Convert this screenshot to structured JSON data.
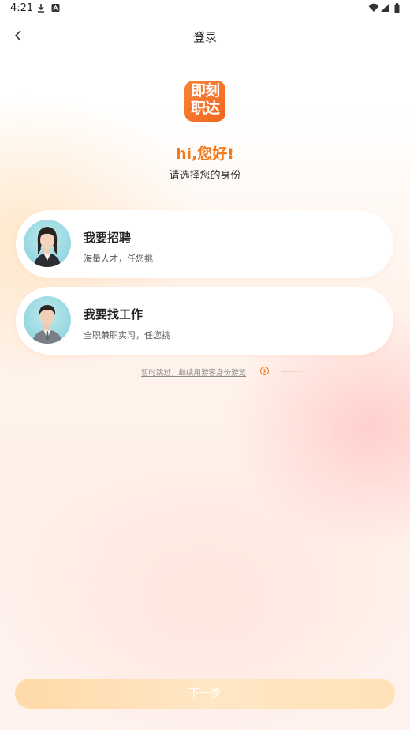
{
  "status_bar": {
    "time": "4:21"
  },
  "header": {
    "title": "登录"
  },
  "logo": {
    "line1": "即刻",
    "line2": "职达"
  },
  "greeting": {
    "title": "hi,您好!",
    "subtitle": "请选择您的身份"
  },
  "roles": [
    {
      "title": "我要招聘",
      "desc": "海量人才，任您挑"
    },
    {
      "title": "我要找工作",
      "desc": "全职兼职实习，任您挑"
    }
  ],
  "guest": {
    "label": "暂时跳过，继续用游客身份游览"
  },
  "footer": {
    "next_label": "下一步"
  },
  "colors": {
    "accent": "#f0791e",
    "logo_bg": "#f2651d",
    "button_bg": "#ffdcae"
  }
}
